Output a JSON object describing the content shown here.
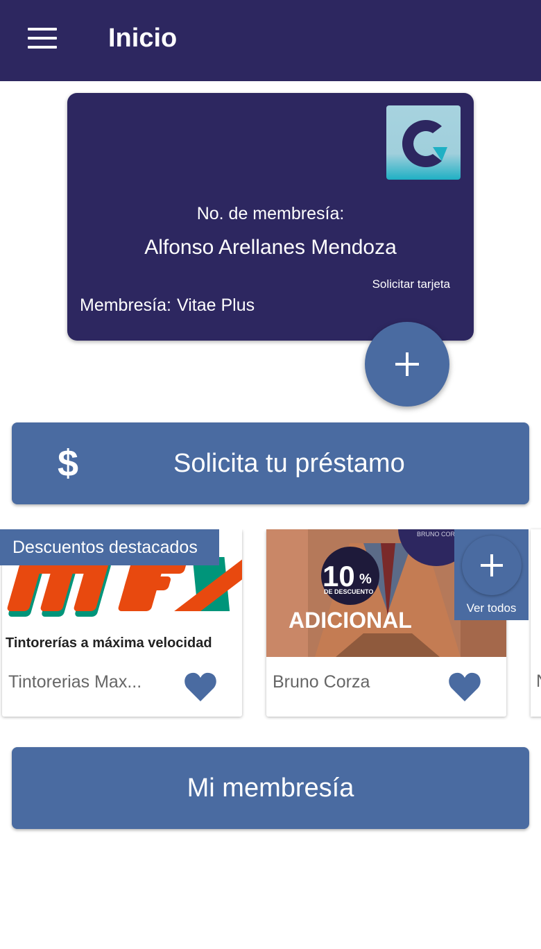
{
  "appbar": {
    "title": "Inicio",
    "menu_icon": "hamburger-menu-icon"
  },
  "membership_card": {
    "member_no_label": "No. de membresía:",
    "member_name": "Alfonso Arellanes Mendoza",
    "request_card_link": "Solicitar tarjeta",
    "membership_label": "Membresía:",
    "membership_value": "Vitae Plus",
    "logo_letter": "C",
    "add_icon": "plus-icon"
  },
  "loan_button": {
    "icon": "dollar-icon",
    "icon_glyph": "$",
    "label": "Solicita tu préstamo"
  },
  "featured": {
    "section_label": "Descuentos destacados",
    "see_all_label": "Ver todos",
    "items": [
      {
        "name": "Tintorerias Max...",
        "logo_text": "mFx",
        "tagline": "Tintorerías a máxima velocidad",
        "favorite": true
      },
      {
        "name": "Bruno Corza",
        "promo_percent": "10",
        "promo_percent_sign": "%",
        "promo_subtitle": "DE DESCUENTO",
        "promo_banner": "ADICIONAL",
        "brand_badge": "BRUNO CORZA",
        "favorite": true
      },
      {
        "name": "N"
      }
    ]
  },
  "membership_button": {
    "label": "Mi membresía"
  },
  "colors": {
    "primary_dark": "#2d2760",
    "accent_blue": "#4a6ba1",
    "logo_teal": "#9fd0dc",
    "promo_orange": "#e8490f",
    "promo_green": "#00957a"
  }
}
